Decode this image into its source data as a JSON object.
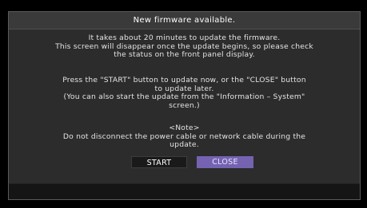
{
  "dialog": {
    "title": "New firmware available.",
    "paragraph1": [
      "It takes about 20 minutes to update the firmware.",
      "This screen will disappear once the update begins, so please check",
      "the status on the front panel display."
    ],
    "paragraph2": [
      "Press the \"START\" button to update now, or the \"CLOSE\" button",
      "to update later.",
      "(You can also start the update from the \"Information – System\"",
      "screen.)"
    ],
    "paragraph3": [
      "<Note>",
      "Do not disconnect the power cable or network cable during the",
      "update."
    ],
    "buttons": {
      "start_label": "START",
      "close_label": "CLOSE",
      "selected": "CLOSE"
    }
  },
  "colors": {
    "background": "#000000",
    "dialog_background": "#2c2c2c",
    "text": "#e4e4e4",
    "selected_button": "#7563b1",
    "unselected_button": "#1a1a1a"
  }
}
